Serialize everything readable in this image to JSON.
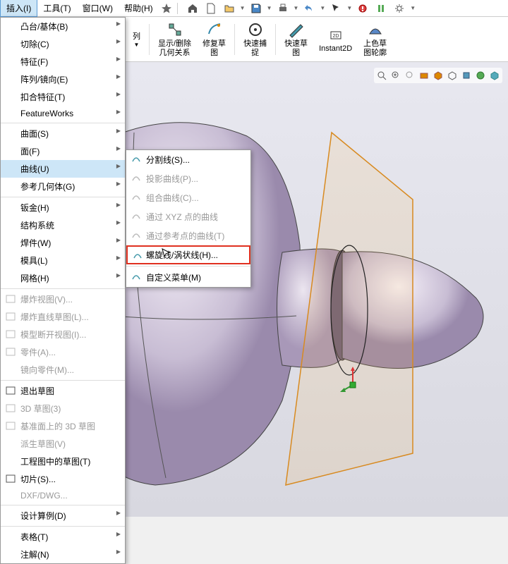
{
  "menubar": {
    "items": [
      {
        "label": "插入(I)",
        "active": true
      },
      {
        "label": "工具(T)"
      },
      {
        "label": "窗口(W)"
      },
      {
        "label": "帮助(H)"
      }
    ]
  },
  "toolbar": {
    "items": [
      {
        "label": "列",
        "sub": true
      },
      {
        "label": "显示/删除\n几何关系",
        "sub": true
      },
      {
        "label": "修复草\n图"
      },
      {
        "label": "快速捕\n捉",
        "sub": true
      },
      {
        "label": "快速草\n图"
      },
      {
        "label": "Instant2D"
      },
      {
        "label": "上色草\n图轮廓"
      }
    ]
  },
  "dropdown": {
    "items": [
      {
        "label": "凸台/基体(B)",
        "sub": true
      },
      {
        "label": "切除(C)",
        "sub": true
      },
      {
        "label": "特征(F)",
        "sub": true
      },
      {
        "label": "阵列/镜向(E)",
        "sub": true
      },
      {
        "label": "扣合特征(T)",
        "sub": true
      },
      {
        "label": "FeatureWorks",
        "sub": true
      },
      {
        "sep": true
      },
      {
        "label": "曲面(S)",
        "sub": true
      },
      {
        "label": "面(F)",
        "sub": true
      },
      {
        "label": "曲线(U)",
        "sub": true,
        "hover": true
      },
      {
        "label": "参考几何体(G)",
        "sub": true
      },
      {
        "sep": true
      },
      {
        "label": "钣金(H)",
        "sub": true
      },
      {
        "label": "结构系统",
        "sub": true
      },
      {
        "label": "焊件(W)",
        "sub": true
      },
      {
        "label": "模具(L)",
        "sub": true
      },
      {
        "label": "网格(H)",
        "sub": true
      },
      {
        "sep": true
      },
      {
        "label": "爆炸视图(V)...",
        "disabled": true,
        "icon": true
      },
      {
        "label": "爆炸直线草图(L)...",
        "disabled": true,
        "icon": true
      },
      {
        "label": "模型断开视图(I)...",
        "disabled": true,
        "icon": true
      },
      {
        "label": "零件(A)...",
        "disabled": true,
        "icon": true
      },
      {
        "label": "镜向零件(M)...",
        "disabled": true
      },
      {
        "sep": true
      },
      {
        "label": "退出草图",
        "icon": true
      },
      {
        "label": "3D 草图(3)",
        "disabled": true,
        "icon": true
      },
      {
        "label": "基准面上的 3D 草图",
        "disabled": true,
        "icon": true
      },
      {
        "label": "派生草图(V)",
        "disabled": true
      },
      {
        "label": "工程图中的草图(T)"
      },
      {
        "label": "切片(S)...",
        "icon": true
      },
      {
        "label": "DXF/DWG...",
        "disabled": true
      },
      {
        "sep": true
      },
      {
        "label": "设计算例(D)",
        "sub": true
      },
      {
        "sep": true
      },
      {
        "label": "表格(T)",
        "sub": true
      },
      {
        "label": "注解(N)",
        "sub": true
      }
    ]
  },
  "submenu": {
    "items": [
      {
        "label": "分割线(S)..."
      },
      {
        "label": "投影曲线(P)...",
        "disabled": true
      },
      {
        "label": "组合曲线(C)...",
        "disabled": true
      },
      {
        "label": "通过 XYZ 点的曲线",
        "disabled": true
      },
      {
        "label": "通过参考点的曲线(T)",
        "disabled": true
      },
      {
        "label": "螺旋线/涡状线(H)...",
        "highlight": true
      },
      {
        "sep": true
      },
      {
        "label": "自定义菜单(M)"
      }
    ]
  }
}
